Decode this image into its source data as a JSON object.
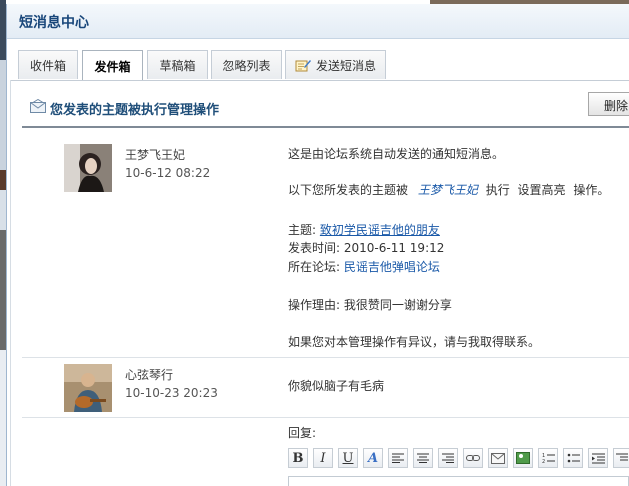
{
  "window": {
    "title": "短消息中心"
  },
  "tabs": [
    {
      "label": "收件箱"
    },
    {
      "label": "发件箱",
      "active": true
    },
    {
      "label": "草稿箱"
    },
    {
      "label": "忽略列表"
    },
    {
      "label": "发送短消息",
      "icon": "compose-icon"
    }
  ],
  "subject": {
    "icon": "envelope-icon",
    "text": "您发表的主题被执行管理操作"
  },
  "actions": {
    "delete_label": "删除"
  },
  "messages": [
    {
      "author": "王梦飞王妃",
      "time": "10-6-12 08:22",
      "body": {
        "line1": "这是由论坛系统自动发送的通知短消息。",
        "line2_prefix": "以下您所发表的主题被",
        "line2_user": "王梦飞王妃",
        "line2_mid": "执行",
        "line2_action": "设置高亮",
        "line2_suffix": "操作。",
        "topic_label": "主题:",
        "topic_link": "致初学民谣吉他的朋友",
        "time_label": "发表时间:",
        "time_value": "2010-6-11 19:12",
        "forum_label": "所在论坛:",
        "forum_link": "民谣吉他弹唱论坛",
        "reason_label": "操作理由:",
        "reason_value": "我很赞同一谢谢分享",
        "footer": "如果您对本管理操作有异议，请与我取得联系。"
      }
    },
    {
      "author": "心弦琴行",
      "time": "10-10-23 20:23",
      "body": {
        "text": "你貌似脑子有毛病"
      }
    }
  ],
  "reply": {
    "label": "回复:"
  },
  "editor_toolbar": [
    "bold-icon",
    "italic-icon",
    "underline-icon",
    "font-color-icon",
    "align-left-icon",
    "align-center-icon",
    "align-right-icon",
    "link-icon",
    "email-icon",
    "image-icon",
    "ordered-list-icon",
    "unordered-list-icon",
    "indent-icon"
  ]
}
